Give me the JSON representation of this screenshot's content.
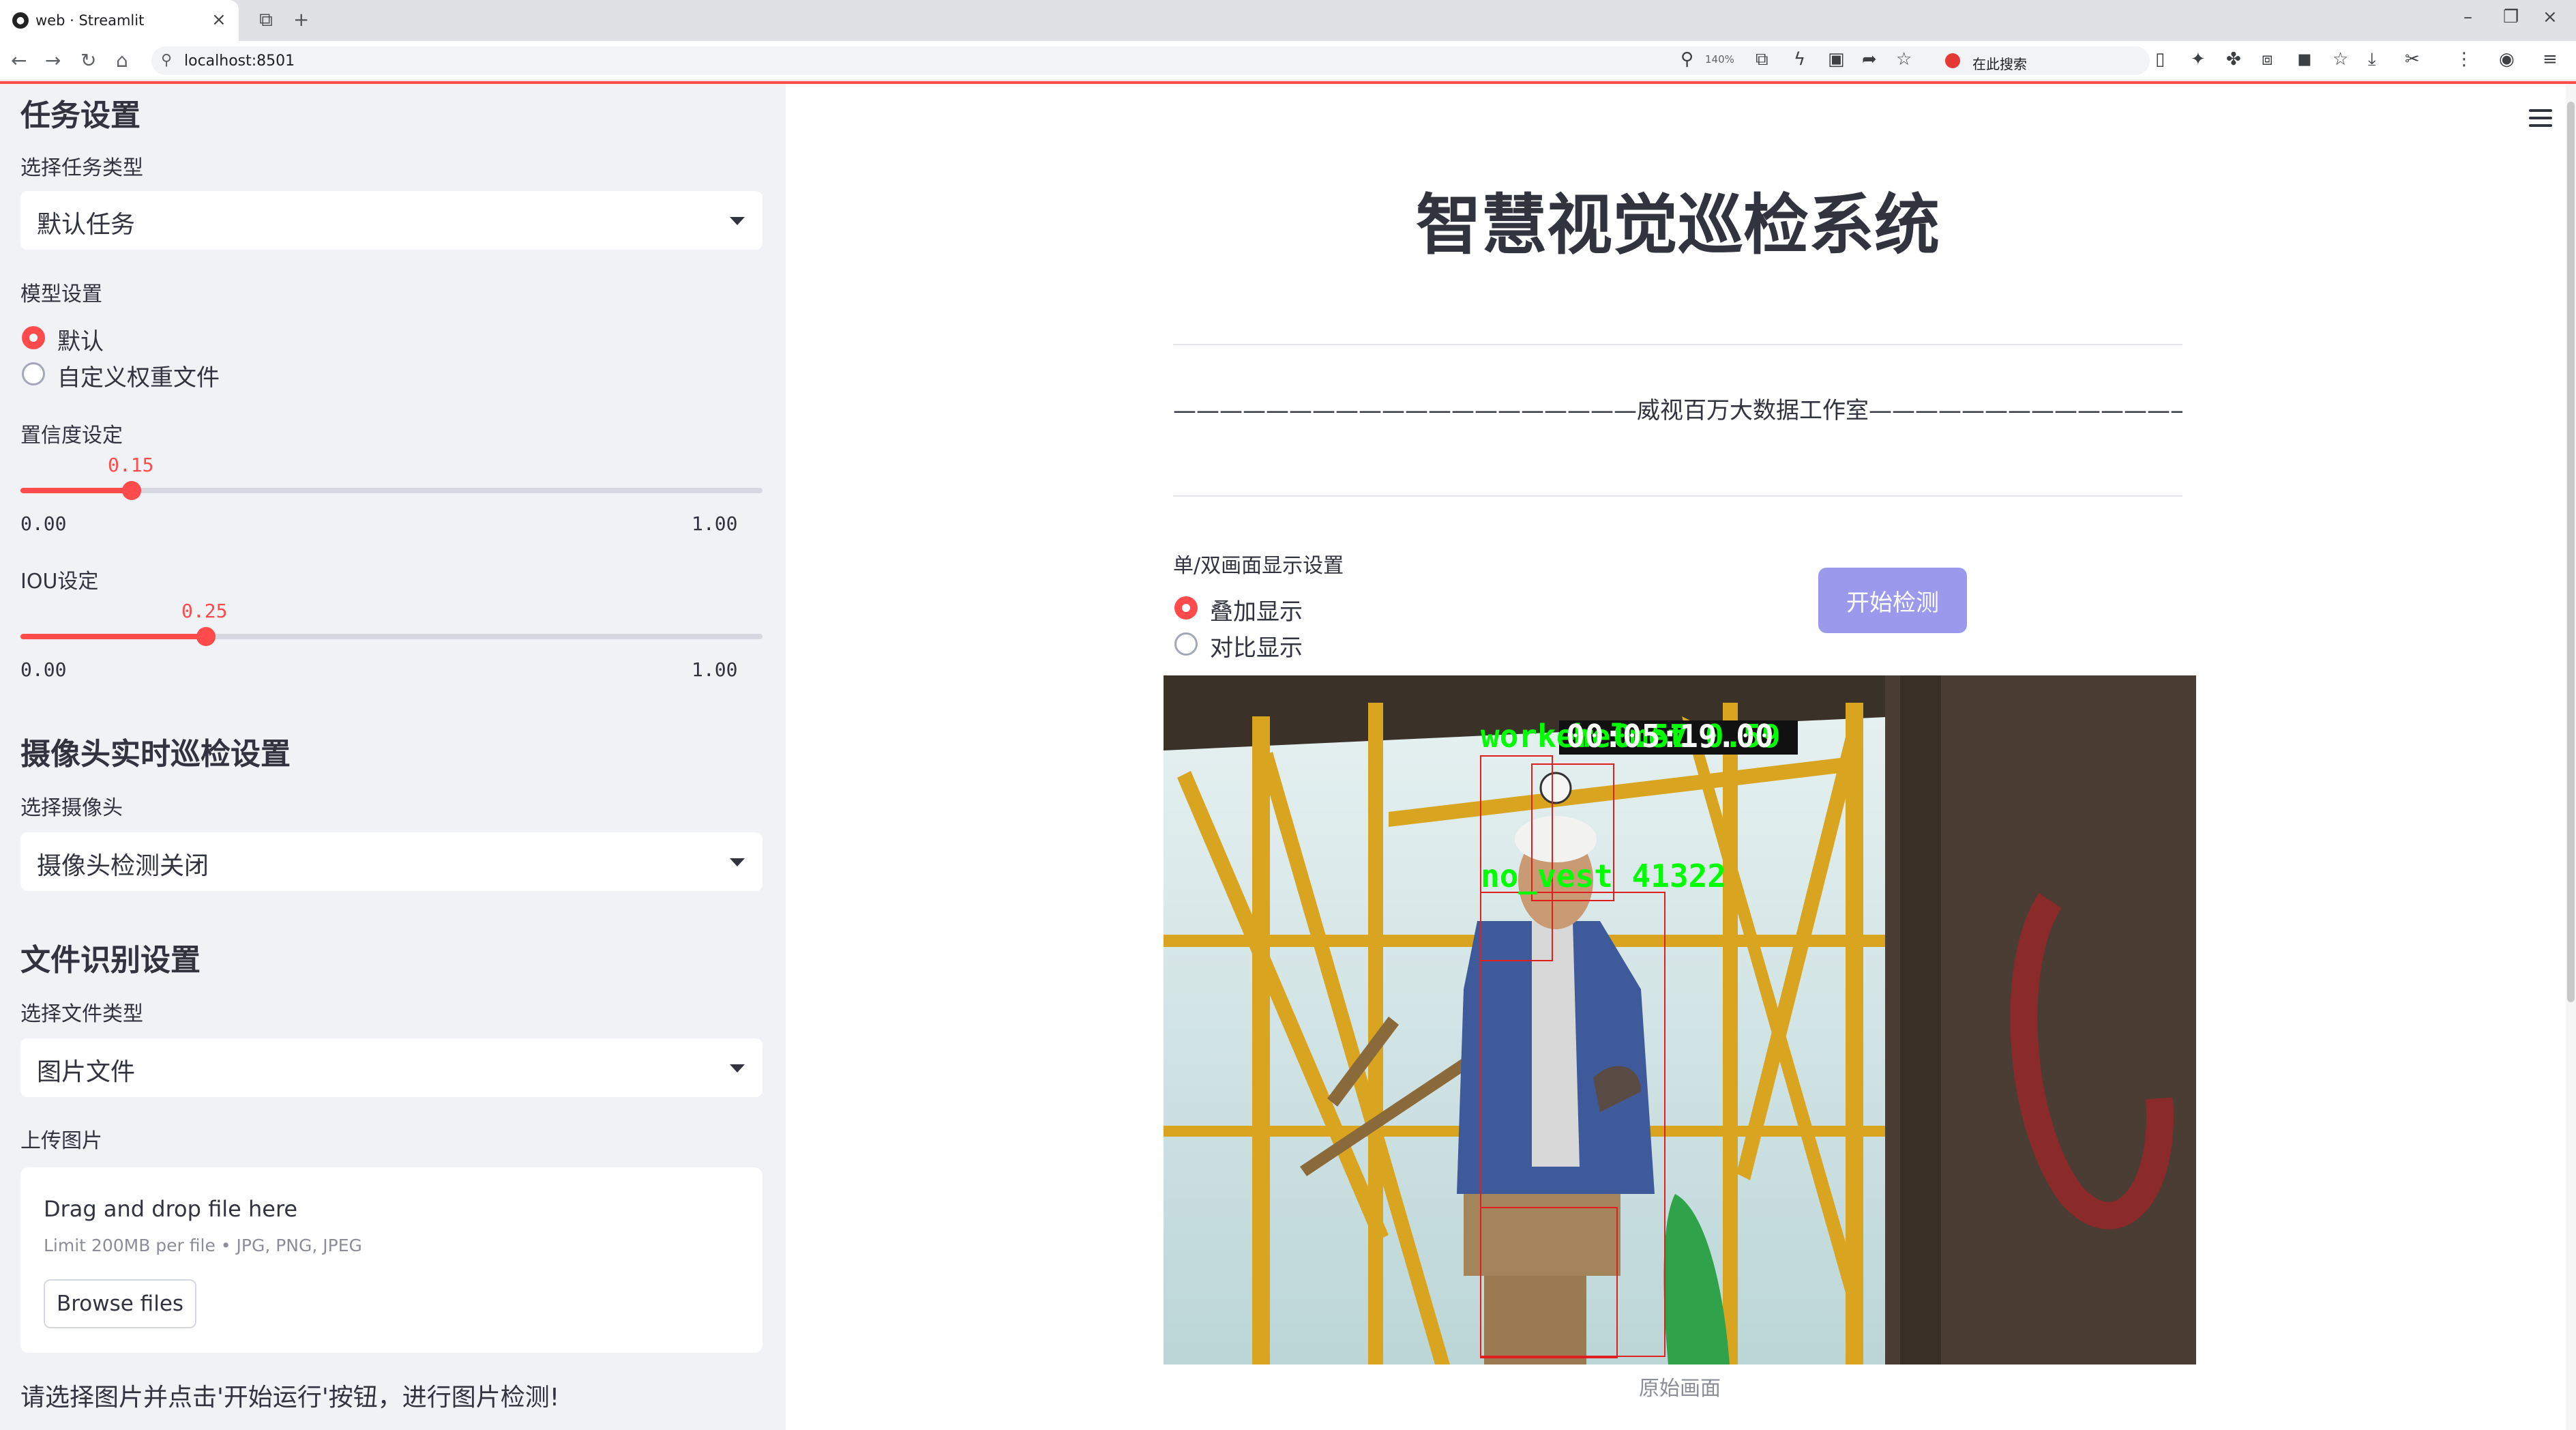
{
  "browser": {
    "tab_title": "web · Streamlit",
    "url": "localhost:8501",
    "zoom": "140%",
    "search_placeholder": "在此搜索"
  },
  "sidebar": {
    "task_heading": "任务设置",
    "task_type_label": "选择任务类型",
    "task_type_value": "默认任务",
    "model_label": "模型设置",
    "model_options": [
      "默认",
      "自定义权重文件"
    ],
    "model_selected": 0,
    "confidence": {
      "label": "置信度设定",
      "value": 0.15,
      "value_text": "0.15",
      "min": "0.00",
      "max": "1.00"
    },
    "iou": {
      "label": "IOU设定",
      "value": 0.25,
      "value_text": "0.25",
      "min": "0.00",
      "max": "1.00"
    },
    "camera_heading": "摄像头实时巡检设置",
    "camera_label": "选择摄像头",
    "camera_value": "摄像头检测关闭",
    "file_heading": "文件识别设置",
    "file_type_label": "选择文件类型",
    "file_type_value": "图片文件",
    "upload_label": "上传图片",
    "upload_title": "Drag and drop file here",
    "upload_limit": "Limit 200MB per file • JPG, PNG, JPEG",
    "browse_label": "Browse files",
    "note": "请选择图片并点击'开始运行'按钮，进行图片检测!"
  },
  "main": {
    "title": "智慧视觉巡检系统",
    "subtitle": "————————————————————威视百万大数据工作室—————————————————————",
    "display_label": "单/双画面显示设置",
    "display_options": [
      "叠加显示",
      "对比显示"
    ],
    "display_selected": 0,
    "start_button": "开始检测",
    "detections": [
      {
        "label": "worker 0.57",
        "color": "#00ff00"
      },
      {
        "label": "helmet 0.59",
        "color": "#00ff00"
      },
      {
        "label": "00:05:19.00",
        "color": "#ffffff"
      },
      {
        "label": "no_vest 41322",
        "color": "#00ff00"
      }
    ],
    "caption": "原始画面"
  },
  "colors": {
    "accent": "#ff4b4b",
    "button": "#9b99ec",
    "sidebar_bg": "#f0f2f6"
  }
}
